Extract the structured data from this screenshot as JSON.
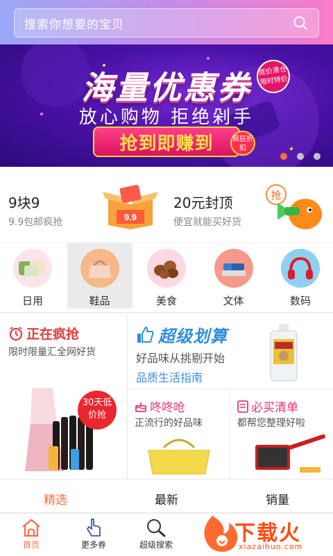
{
  "search": {
    "placeholder": "搜索你想要的宝贝"
  },
  "banner": {
    "title": "海量优惠券",
    "subtitle": "放心购物 拒绝剁手",
    "pill": "抢到即赚到",
    "pill_badge": "疯狂折扣",
    "corner_badge": "底价清仓限时特价",
    "dots": 3,
    "active_dot": 0
  },
  "promo": {
    "left_title": "9块9",
    "left_sub": "9.9包邮疯抢",
    "box_label": "9.9",
    "right_title": "20元封顶",
    "right_sub": "便宜就能买好货",
    "mascot_label": "抢"
  },
  "categories": [
    {
      "label": "日用",
      "icon": "pillows-icon",
      "bg": "#fde3ea"
    },
    {
      "label": "鞋品",
      "icon": "handbag-icon",
      "bg": "#f7b88a",
      "selected": true
    },
    {
      "label": "美食",
      "icon": "chestnuts-icon",
      "bg": "#fcd9e2"
    },
    {
      "label": "文体",
      "icon": "stapler-icon",
      "bg": "#f59a8a"
    },
    {
      "label": "数码",
      "icon": "headphones-icon",
      "bg": "#8fd0f0"
    }
  ],
  "features": {
    "big": {
      "title": "正在疯抢",
      "desc": "限时限量汇全网好货",
      "badge": "30天低价抢"
    },
    "top": {
      "title": "超级划算",
      "desc": "好品味从挑剔开始",
      "link": "品质生活指南"
    },
    "a": {
      "title": "咚咚呛",
      "desc": "正流行的好品味"
    },
    "b": {
      "title": "必买清单",
      "desc": "都帮您整理好啦"
    }
  },
  "sorts": [
    {
      "label": "精选",
      "active": true
    },
    {
      "label": "最新",
      "active": false
    },
    {
      "label": "销量",
      "active": false
    }
  ],
  "nav": [
    {
      "label": "首页",
      "icon": "home-icon",
      "active": true
    },
    {
      "label": "更多券",
      "icon": "hand-pointer-icon",
      "active": false
    },
    {
      "label": "超级搜索",
      "icon": "magnifier-icon",
      "active": false
    }
  ],
  "watermark": {
    "text": "下载火",
    "url": "xiazaihuo.com"
  },
  "colors": {
    "accent": "#ff6a3c",
    "red": "#e33a3a",
    "blue": "#2e8de0",
    "pink": "#e8336c"
  }
}
